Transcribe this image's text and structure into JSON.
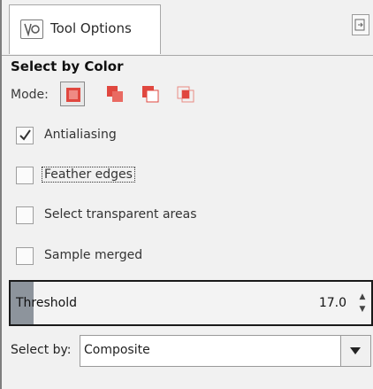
{
  "tab": {
    "label": "Tool Options",
    "icon": "tool-options-icon",
    "menu_icon": "tab-menu-icon"
  },
  "tool": {
    "title": "Select by Color"
  },
  "mode": {
    "label": "Mode:",
    "options": [
      {
        "name": "replace",
        "icon": "replace-selection-icon",
        "active": true
      },
      {
        "name": "add",
        "icon": "add-selection-icon",
        "active": false
      },
      {
        "name": "subtract",
        "icon": "subtract-selection-icon",
        "active": false
      },
      {
        "name": "intersect",
        "icon": "intersect-selection-icon",
        "active": false
      }
    ]
  },
  "options": {
    "antialiasing": {
      "label": "Antialiasing",
      "checked": true
    },
    "feather_edges": {
      "label": "Feather edges",
      "checked": false
    },
    "select_transparent": {
      "label": "Select transparent areas",
      "checked": false
    },
    "sample_merged": {
      "label": "Sample merged",
      "checked": false
    }
  },
  "threshold": {
    "label": "Threshold",
    "value": "17.0"
  },
  "select_by": {
    "label": "Select by:",
    "value": "Composite"
  },
  "colors": {
    "mode_red": "#e0473f",
    "panel_bg": "#f1f1f1",
    "threshold_fill": "#8d949c"
  }
}
